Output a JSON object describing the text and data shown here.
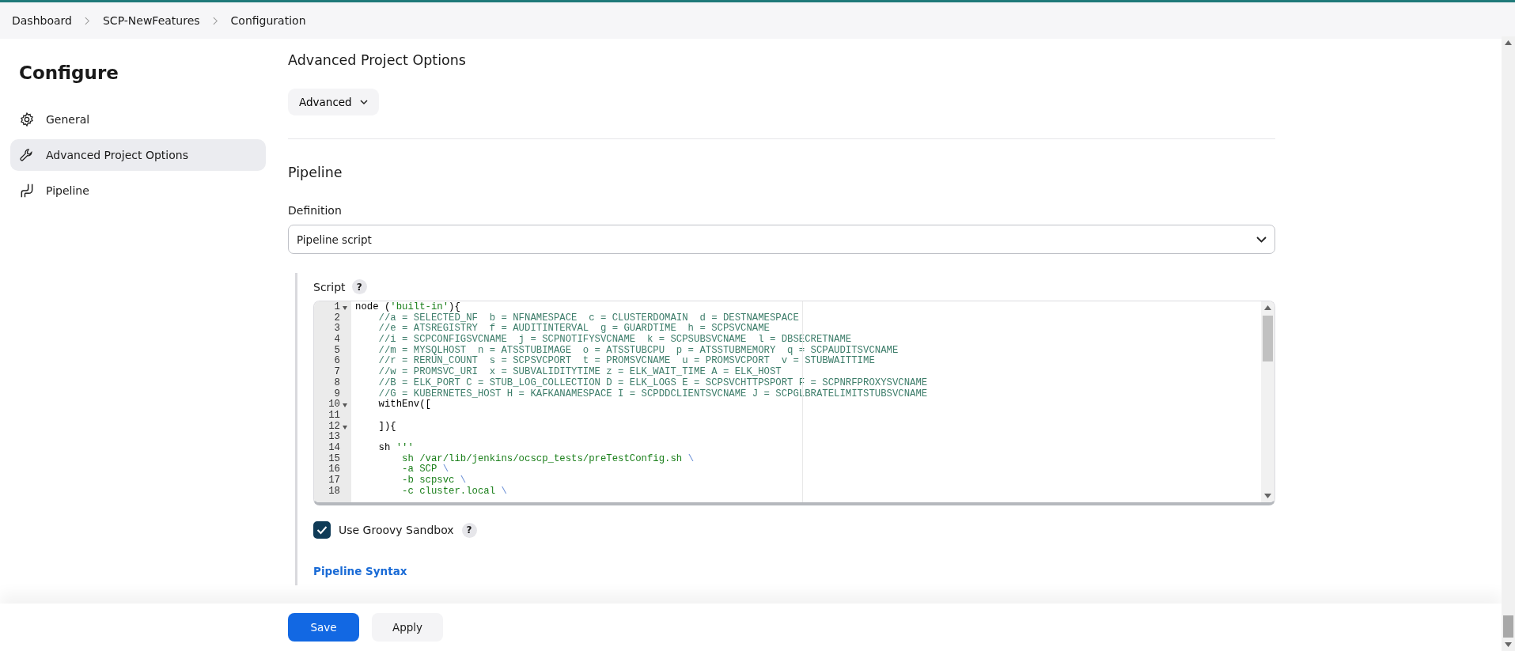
{
  "breadcrumbs": [
    {
      "label": "Dashboard"
    },
    {
      "label": "SCP-NewFeatures"
    },
    {
      "label": "Configuration"
    }
  ],
  "sidebar": {
    "title": "Configure",
    "items": [
      {
        "label": "General",
        "selected": false
      },
      {
        "label": "Advanced Project Options",
        "selected": true
      },
      {
        "label": "Pipeline",
        "selected": false
      }
    ]
  },
  "advanced_section": {
    "heading": "Advanced Project Options",
    "button": "Advanced"
  },
  "pipeline_section": {
    "heading": "Pipeline",
    "definition_label": "Definition",
    "definition_value": "Pipeline script",
    "script_label": "Script",
    "help": "?",
    "editor": {
      "lines": [
        {
          "number": "1",
          "fold": true,
          "segments": [
            {
              "kind": "plain",
              "text": "node ("
            },
            {
              "kind": "string",
              "text": "'built-in'"
            },
            {
              "kind": "plain",
              "text": "){"
            }
          ]
        },
        {
          "number": "2",
          "fold": false,
          "segments": [
            {
              "kind": "comment",
              "text": "    //a = SELECTED_NF  b = NFNAMESPACE  c = CLUSTERDOMAIN  d = DESTNAMESPACE"
            }
          ]
        },
        {
          "number": "3",
          "fold": false,
          "segments": [
            {
              "kind": "comment",
              "text": "    //e = ATSREGISTRY  f = AUDITINTERVAL  g = GUARDTIME  h = SCPSVCNAME"
            }
          ]
        },
        {
          "number": "4",
          "fold": false,
          "segments": [
            {
              "kind": "comment",
              "text": "    //i = SCPCONFIGSVCNAME  j = SCPNOTIFYSVCNAME  k = SCPSUBSVCNAME  l = DBSECRETNAME"
            }
          ]
        },
        {
          "number": "5",
          "fold": false,
          "segments": [
            {
              "kind": "comment",
              "text": "    //m = MYSQLHOST  n = ATSSTUBIMAGE  o = ATSSTUBCPU  p = ATSSTUBMEMORY  q = SCPAUDITSVCNAME"
            }
          ]
        },
        {
          "number": "6",
          "fold": false,
          "segments": [
            {
              "kind": "comment",
              "text": "    //r = RERUN_COUNT  s = SCPSVCPORT  t = PROMSVCNAME  u = PROMSVCPORT  v = STUBWAITTIME"
            }
          ]
        },
        {
          "number": "7",
          "fold": false,
          "segments": [
            {
              "kind": "comment",
              "text": "    //w = PROMSVC_URI  x = SUBVALIDITYTIME z = ELK_WAIT_TIME A = ELK_HOST"
            }
          ]
        },
        {
          "number": "8",
          "fold": false,
          "segments": [
            {
              "kind": "comment",
              "text": "    //B = ELK_PORT C = STUB_LOG_COLLECTION D = ELK_LOGS E = SCPSVCHTTPSPORT F = SCPNRFPROXYSVCNAME"
            }
          ]
        },
        {
          "number": "9",
          "fold": false,
          "segments": [
            {
              "kind": "comment",
              "text": "    //G = KUBERNETES_HOST H = KAFKANAMESPACE I = SCPDDCLIENTSVCNAME J = SCPGLBRATELIMITSTUBSVCNAME"
            }
          ]
        },
        {
          "number": "10",
          "fold": true,
          "segments": [
            {
              "kind": "plain",
              "text": "    withEnv(["
            }
          ]
        },
        {
          "number": "11",
          "fold": false
        },
        {
          "number": "12",
          "fold": true,
          "segments": [
            {
              "kind": "plain",
              "text": "    ]){"
            }
          ]
        },
        {
          "number": "13",
          "fold": false
        },
        {
          "number": "14",
          "fold": false,
          "segments": [
            {
              "kind": "plain",
              "text": "    sh "
            },
            {
              "kind": "string",
              "text": "'''"
            }
          ]
        },
        {
          "number": "15",
          "fold": false,
          "segments": [
            {
              "kind": "string",
              "text": "        sh /var/lib/jenkins/ocscp_tests/preTestConfig.sh "
            },
            {
              "kind": "escape",
              "text": "\\"
            }
          ]
        },
        {
          "number": "16",
          "fold": false,
          "segments": [
            {
              "kind": "string",
              "text": "        -a SCP "
            },
            {
              "kind": "escape",
              "text": "\\"
            }
          ]
        },
        {
          "number": "17",
          "fold": false,
          "segments": [
            {
              "kind": "string",
              "text": "        -b scpsvc "
            },
            {
              "kind": "escape",
              "text": "\\"
            }
          ]
        },
        {
          "number": "18",
          "fold": false,
          "segments": [
            {
              "kind": "string",
              "text": "        -c cluster.local "
            },
            {
              "kind": "escape",
              "text": "\\"
            }
          ]
        }
      ]
    },
    "sandbox": {
      "label": "Use Groovy Sandbox",
      "checked": true
    },
    "syntax_link": "Pipeline Syntax"
  },
  "footer": {
    "save": "Save",
    "apply": "Apply"
  }
}
